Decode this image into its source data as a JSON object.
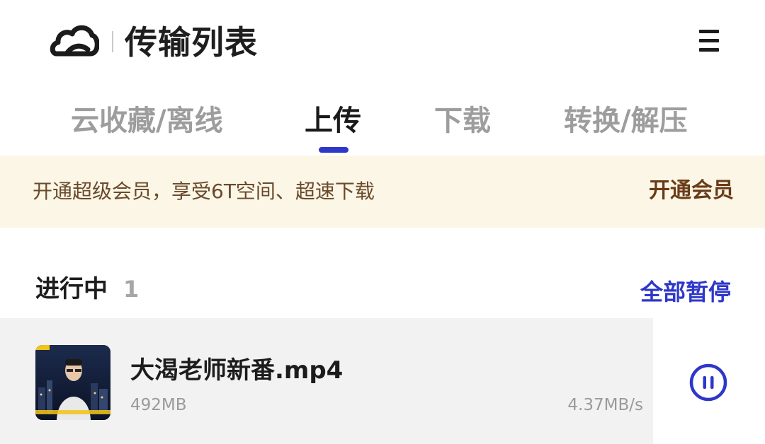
{
  "header": {
    "title": "传输列表",
    "logo_icon": "cloud-icon",
    "menu_icon": "hamburger-menu-icon"
  },
  "tabs": [
    {
      "label": "云收藏/离线",
      "active": false
    },
    {
      "label": "上传",
      "active": true
    },
    {
      "label": "下载",
      "active": false
    },
    {
      "label": "转换/解压",
      "active": false
    }
  ],
  "banner": {
    "text": "开通超级会员，享受6T空间、超速下载",
    "button_label": "开通会员"
  },
  "in_progress": {
    "title": "进行中",
    "count": "1",
    "pause_all_label": "全部暂停"
  },
  "transfers": [
    {
      "file_name": "大渴老师新番.mp4",
      "size": "492MB",
      "speed": "4.37MB/s",
      "thumbnail_icon": "video-thumbnail",
      "action_icon": "pause-icon"
    }
  ],
  "colors": {
    "accent": "#2e37c9",
    "banner_bg": "#fbf6e6",
    "banner_text": "#6a4a2c",
    "row_bg": "#f2f2f2"
  }
}
